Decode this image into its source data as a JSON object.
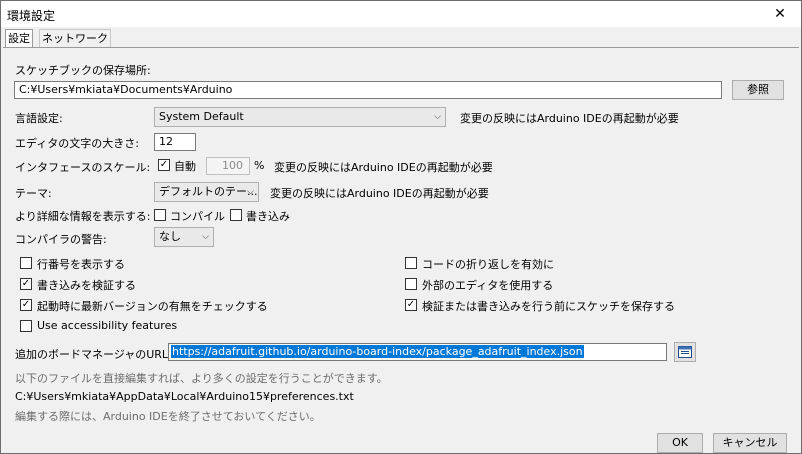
{
  "window": {
    "title": "環境設定",
    "close": "✕"
  },
  "tabs": [
    "設定",
    "ネットワーク"
  ],
  "sketchbook": {
    "label": "スケッチブックの保存場所:",
    "path": "C:¥Users¥mkiata¥Documents¥Arduino",
    "browse": "参照"
  },
  "language": {
    "label": "言語設定:",
    "value": "System Default",
    "note": "変更の反映にはArduino IDEの再起動が必要"
  },
  "font_size": {
    "label": "エディタの文字の大きさ:",
    "value": "12"
  },
  "ui_scale": {
    "label": "インタフェースのスケール:",
    "auto": "自動",
    "percent": "100",
    "unit": "%",
    "note": "変更の反映にはArduino IDEの再起動が必要"
  },
  "theme": {
    "label": "テーマ:",
    "value": "デフォルトのテー...",
    "note": "変更の反映にはArduino IDEの再起動が必要"
  },
  "verbose": {
    "label": "より詳細な情報を表示する:",
    "compile": "コンパイル",
    "upload": "書き込み"
  },
  "warnings": {
    "label": "コンパイラの警告:",
    "value": "なし"
  },
  "options": {
    "line_numbers": "行番号を表示する",
    "verify_upload": "書き込みを検証する",
    "check_updates": "起動時に最新バージョンの有無をチェックする",
    "accessibility": "Use accessibility features",
    "code_folding": "コードの折り返しを有効に",
    "external_editor": "外部のエディタを使用する",
    "save_on_verify": "検証または書き込みを行う前にスケッチを保存する"
  },
  "board_manager": {
    "label": "追加のボードマネージャのURL:",
    "url": "https://adafruit.github.io/arduino-board-index/package_adafruit_index.json"
  },
  "info": {
    "line1": "以下のファイルを直接編集すれば、より多くの設定を行うことができます。",
    "path": "C:¥Users¥mkiata¥AppData¥Local¥Arduino15¥preferences.txt",
    "line3": "編集する際には、Arduino IDEを終了させておいてください。"
  },
  "buttons": {
    "ok": "OK",
    "cancel": "キャンセル"
  },
  "colors": {
    "selection": "#0078d7",
    "background": "#f0f0f0"
  }
}
